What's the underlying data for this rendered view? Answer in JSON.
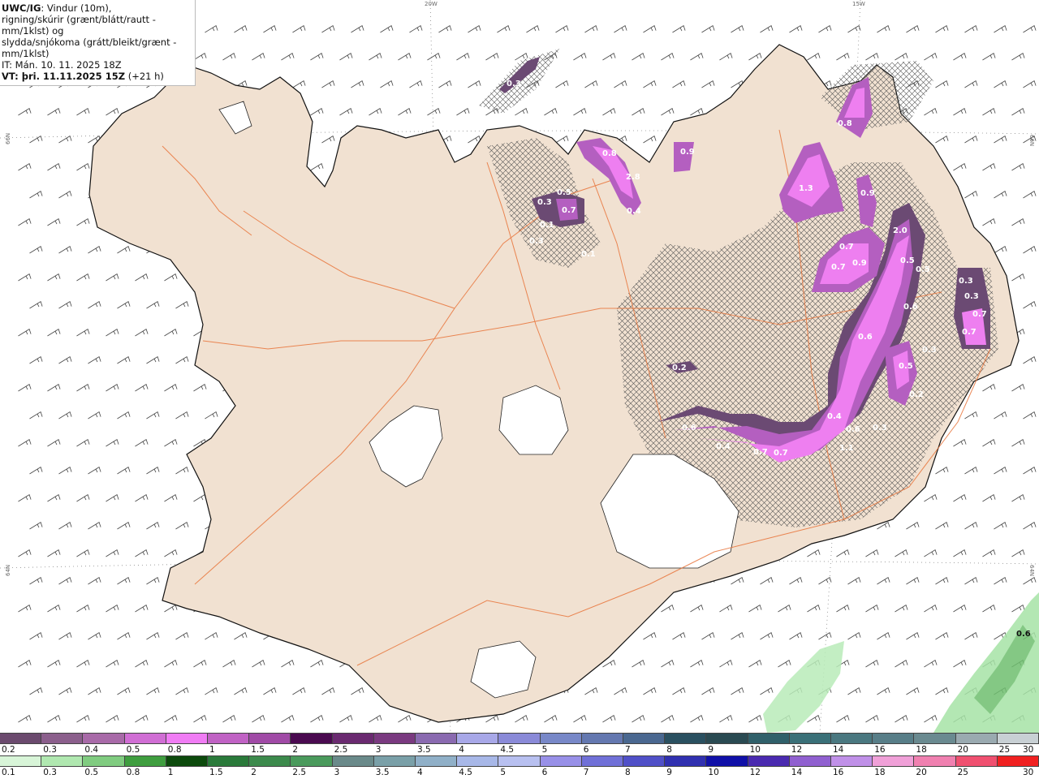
{
  "header": {
    "model": "UWC/IG",
    "line1_rest": ": Vindur (10m),",
    "line2": "rigning/skúrir (grænt/blátt/rautt - mm/1klst) og",
    "line3": "slydda/snjókoma (grátt/bleikt/grænt - mm/1klst)",
    "line4": "IT: Mán. 10. 11. 2025 18Z",
    "line5_bold": "VT: þri. 11.11.2025 15Z",
    "line5_rest": " (+21 h)"
  },
  "graticule": {
    "lon_top": [
      "20W",
      "15W"
    ],
    "lat_left": [
      "66N",
      "64N"
    ],
    "lat_right": [
      "66N",
      "64N"
    ]
  },
  "precip_labels": [
    "0.3",
    "0.8",
    "2.8",
    "0.9",
    "0.3",
    "0.5",
    "0.7",
    "0.1",
    "0.3",
    "0.4",
    "0.1",
    "0.8",
    "1.3",
    "0.9",
    "2.0",
    "0.7",
    "0.7",
    "0.9",
    "0.5",
    "0.5",
    "0.3",
    "0.3",
    "0.7",
    "0.7",
    "0.6",
    "0.6",
    "0.3",
    "0.5",
    "0.2",
    "0.2",
    "0.4",
    "0.6",
    "0.3",
    "1.1",
    "0.6",
    "0.4",
    "0.7",
    "0.7",
    "0.6"
  ],
  "colors": {
    "land": "#f1e1d1",
    "glacier": "#ffffff",
    "roads": "#e8743a",
    "snow_light": "#6b4a73",
    "snow_mid": "#b45fc0",
    "snow_strong": "#ee7ff0",
    "rain": "#a6e3a6"
  },
  "snow_scale": {
    "colors": [
      "#6b4a6e",
      "#8b5f8c",
      "#a86aa8",
      "#d06ed4",
      "#f07cf4",
      "#c062c4",
      "#a04aa6",
      "#4a0a50",
      "#6a2a70",
      "#7a3a80",
      "#8a6ab0",
      "#a8a8e8",
      "#8a8ad8",
      "#7888c8",
      "#6478b0",
      "#4a6890",
      "#2a5060",
      "#2a4a52",
      "#30606a",
      "#3a7078",
      "#4a7880",
      "#587e88",
      "#6a8a90",
      "#9aaab0",
      "#c8d0d4"
    ],
    "labels": [
      "0.2",
      "0.3",
      "0.4",
      "0.5",
      "0.8",
      "1",
      "1.5",
      "2",
      "2.5",
      "3",
      "3.5",
      "4",
      "4.5",
      "5",
      "6",
      "7",
      "8",
      "9",
      "10",
      "12",
      "14",
      "16",
      "18",
      "20",
      "25",
      "30"
    ]
  },
  "rain_scale": {
    "colors": [
      "#d8f5d8",
      "#b0e8b0",
      "#80cc80",
      "#3f9e3f",
      "#0c4a0c",
      "#2a7a3a",
      "#3c8a4c",
      "#4a9a5c",
      "#6a8a8a",
      "#7aa0a8",
      "#90b0c8",
      "#a8b8e8",
      "#b8c0f0",
      "#9890e8",
      "#7070d8",
      "#5050c8",
      "#3030b0",
      "#1010a8",
      "#4a2ab0",
      "#9060d0",
      "#c090e8",
      "#f0a0d8",
      "#f080b0",
      "#f05070",
      "#f02020"
    ],
    "labels": [
      "0.1",
      "0.3",
      "0.5",
      "0.8",
      "1",
      "1.5",
      "2",
      "2.5",
      "3",
      "3.5",
      "4",
      "4.5",
      "5",
      "6",
      "7",
      "8",
      "9",
      "10",
      "12",
      "14",
      "16",
      "18",
      "20",
      "25",
      "30"
    ]
  }
}
